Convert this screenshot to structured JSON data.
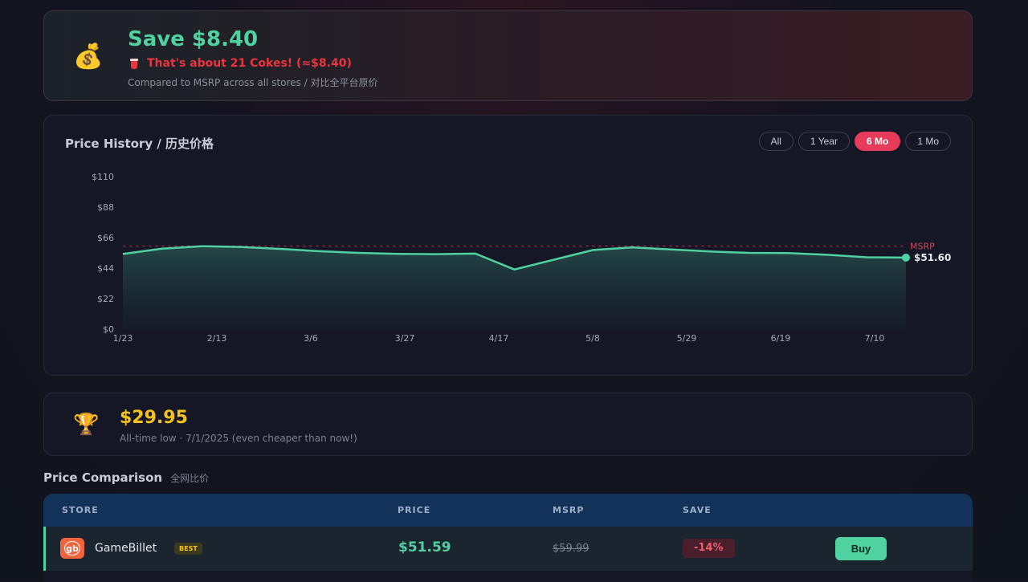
{
  "savings": {
    "icon": "money-bag-icon",
    "title": "Save $8.40",
    "coke_text": "That's about 21 Cokes! (≈$8.40)",
    "subtitle": "Compared to MSRP across all stores / 对比全平台原价"
  },
  "price_history": {
    "title": "Price History / 历史价格",
    "ranges": [
      "All",
      "1 Year",
      "6 Mo",
      "1 Mo"
    ],
    "active_range": "6 Mo",
    "msrp_label": "MSRP",
    "current_label": "$51.60"
  },
  "chart_data": {
    "type": "area",
    "title": "Price History / 历史价格",
    "y_ticks": [
      "$0",
      "$22",
      "$44",
      "$66",
      "$88",
      "$110"
    ],
    "ylim": [
      0,
      110
    ],
    "x_ticks": [
      "1/23",
      "2/13",
      "3/6",
      "3/27",
      "4/17",
      "5/8",
      "5/29",
      "6/19",
      "7/10"
    ],
    "msrp": 59.99,
    "series": [
      {
        "values": [
          54.2,
          58.0,
          59.8,
          59.3,
          57.9,
          56.2,
          55.0,
          54.3,
          54.1,
          54.5,
          43.0,
          50.0,
          57.0,
          59.0,
          57.5,
          56.0,
          55.0,
          54.8,
          53.6,
          51.8,
          51.6
        ]
      }
    ],
    "colors": {
      "line": "#4fd1a0",
      "msrp": "#e63b5a"
    }
  },
  "all_time_low": {
    "icon": "trophy-icon",
    "price": "$29.95",
    "subtitle": "All-time low · 7/1/2025 (even cheaper than now!)"
  },
  "comparison": {
    "title": "Price Comparison",
    "subtitle_cn": "全网比价",
    "headers": {
      "store": "STORE",
      "price": "PRICE",
      "msrp": "MSRP",
      "save": "SAVE"
    },
    "rows": [
      {
        "logo": "gb",
        "store": "GameBillet",
        "badge": "BEST",
        "price": "$51.59",
        "msrp": "$59.99",
        "save": "-14%",
        "action": "Buy"
      }
    ]
  }
}
